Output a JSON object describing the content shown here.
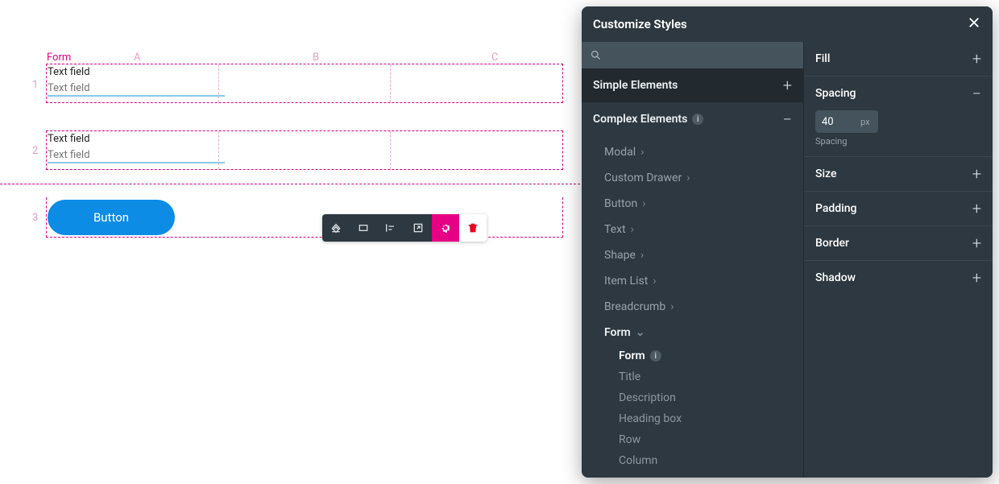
{
  "canvas": {
    "form_label": "Form",
    "columns": [
      "A",
      "B",
      "C"
    ],
    "rows": [
      "1",
      "2",
      "3"
    ],
    "fields": [
      {
        "label": "Text field",
        "placeholder": "Text field"
      },
      {
        "label": "Text field",
        "placeholder": "Text field"
      }
    ],
    "button_label": "Button"
  },
  "toolbar": {
    "icons": [
      "bucket-icon",
      "rectangle-icon",
      "align-icon",
      "open-icon",
      "gear-icon",
      "trash-icon"
    ]
  },
  "panel": {
    "title": "Customize Styles",
    "search_placeholder": "",
    "sections": [
      {
        "title": "Simple Elements",
        "expanded": false
      },
      {
        "title": "Complex Elements",
        "expanded": true,
        "info": true
      }
    ],
    "complex_items": [
      "Modal",
      "Custom Drawer",
      "Button",
      "Text",
      "Shape",
      "Item List",
      "Breadcrumb"
    ],
    "form_item": {
      "label": "Form",
      "children": [
        "Form",
        "Title",
        "Description",
        "Heading box",
        "Row",
        "Column"
      ],
      "selected_index": 0
    },
    "props": [
      {
        "label": "Fill",
        "expanded": false
      },
      {
        "label": "Spacing",
        "expanded": true,
        "value": "40",
        "unit": "px",
        "sub": "Spacing"
      },
      {
        "label": "Size",
        "expanded": false
      },
      {
        "label": "Padding",
        "expanded": false
      },
      {
        "label": "Border",
        "expanded": false
      },
      {
        "label": "Shadow",
        "expanded": false
      }
    ]
  }
}
